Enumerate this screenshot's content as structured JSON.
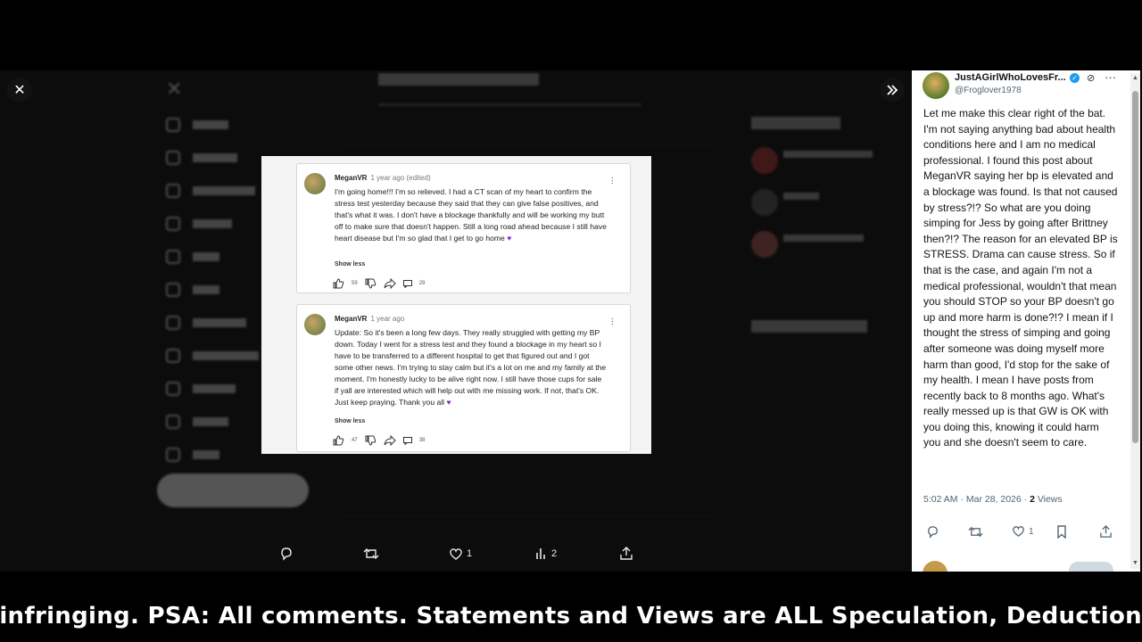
{
  "media_cards": [
    {
      "username": "MeganVR",
      "time": "1 year ago (edited)",
      "body": "I'm going home!!! I'm so relieved.  I had a CT scan of my heart to confirm the stress test yesterday because they said that they can give false positives, and that's what it was. I don't have a blockage thankfully and will be working my butt off to make sure that doesn't happen. Still a long road ahead because I still have heart disease but I'm so glad that I get to go home",
      "show_less": "Show less",
      "likes": "59",
      "replies": "29"
    },
    {
      "username": "MeganVR",
      "time": "1 year ago",
      "body": "Update: So it's been a long few days. They really struggled with getting my BP down. Today I went for a stress test and they found a blockage in my heart so I have to be transferred to a different hospital to get that figured out and I got some other news. I'm trying to stay calm but it's a lot on me and my family at the moment. I'm honestly lucky to be alive right now. I still have those cups for sale if yall are interested which will help out with me missing work. If not, that's OK. Just keep praying. Thank you all",
      "show_less": "Show less",
      "likes": "47",
      "replies": "38"
    }
  ],
  "bottom_actions": {
    "likes": "1",
    "views": "2"
  },
  "post": {
    "display_name": "JustAGirlWhoLovesFr...",
    "handle": "@Froglover1978",
    "text": "Let me make this clear right of the bat. I'm not saying anything bad about health conditions here and I am no medical professional. I found this post about MeganVR saying her bp is elevated and a blockage was found. Is that not caused by stress?!? So what are you doing simping for Jess by going after Brittney then?!?  The reason for an elevated BP is STRESS. Drama can cause stress. So if that is the case, and again I'm not a medical professional, wouldn't that mean you should STOP so your BP doesn't go up and more harm is done?!? I mean if I thought the stress of simping and going after someone was doing myself more harm than good, I'd stop for the sake of my health.  I mean I have posts from recently back to 8 months ago. What's really messed up is that GW is OK with you doing this, knowing it could harm you and she doesn't seem to care.",
    "timestamp": "5:02 AM · Mar 28, 2026 · ",
    "views_count": "2",
    "views_label": " Views",
    "likes": "1"
  },
  "ticker": "otherwise be infringing.  PSA: All comments. Statements and Views are ALL Speculation, Deduction",
  "colors": {
    "panel_bg": "#ffffff",
    "verified": "#1d9bf0",
    "heart_emoji": "#7b2ec7"
  }
}
